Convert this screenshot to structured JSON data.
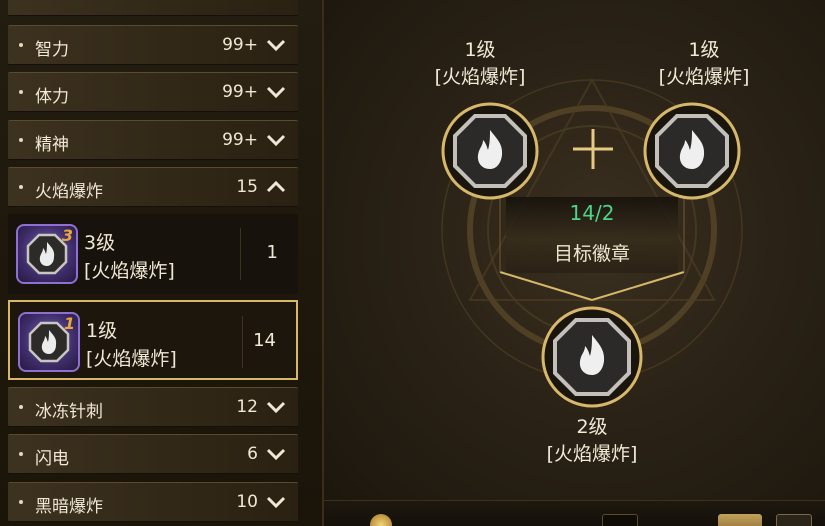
{
  "categories_top": [
    {
      "label": "智力",
      "count": "99+",
      "state": "collapsed"
    },
    {
      "label": "体力",
      "count": "99+",
      "state": "collapsed"
    },
    {
      "label": "精神",
      "count": "99+",
      "state": "collapsed"
    },
    {
      "label": "火焰爆炸",
      "count": "15",
      "state": "expanded"
    }
  ],
  "badge_items": [
    {
      "level_mark": "3",
      "name_line1": "3级",
      "name_line2": "[火焰爆炸]",
      "qty": "1",
      "selected": false
    },
    {
      "level_mark": "1",
      "name_line1": "1级",
      "name_line2": "[火焰爆炸]",
      "qty": "14",
      "selected": true
    }
  ],
  "categories_bottom": [
    {
      "label": "冰冻针刺",
      "count": "12",
      "state": "collapsed"
    },
    {
      "label": "闪电",
      "count": "6",
      "state": "collapsed"
    },
    {
      "label": "黑暗爆炸",
      "count": "10",
      "state": "collapsed"
    }
  ],
  "synthesis": {
    "left_input": {
      "line1": "1级",
      "line2": "[火焰爆炸]"
    },
    "right_input": {
      "line1": "1级",
      "line2": "[火焰爆炸]"
    },
    "progress": "14/2",
    "target_label": "目标徽章",
    "output": {
      "line1": "2级",
      "line2": "[火焰爆炸]"
    }
  },
  "icons": {
    "badge": "fire-badge-icon",
    "plus": "plus-icon",
    "chevron_down": "chevron-down-icon",
    "chevron_up": "chevron-up-icon"
  },
  "colors": {
    "accent_gold": "#d7b76a",
    "progress_green": "#4fd38b",
    "rare_purple": "#8f6fd0"
  }
}
